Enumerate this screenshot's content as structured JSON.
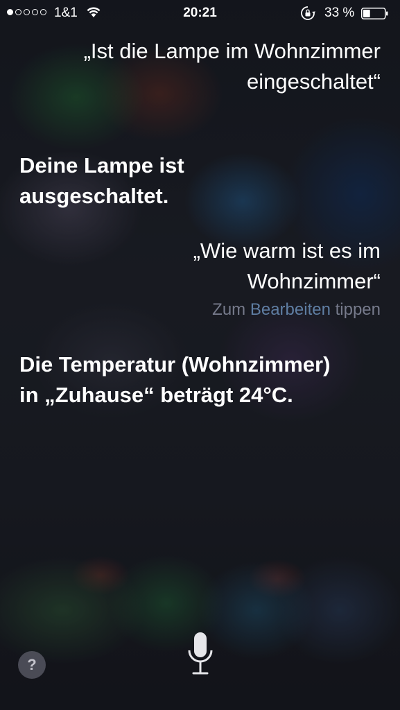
{
  "status_bar": {
    "signal_dots_filled": 1,
    "signal_dots_total": 5,
    "carrier": "1&1",
    "time": "20:21",
    "battery_percent": "33 %",
    "battery_level": 0.33
  },
  "conversation": {
    "user_query_1": "„Ist die Lampe im Wohnzimmer eingeschaltet“",
    "siri_answer_1": "Deine Lampe ist ausgeschaltet.",
    "user_query_2": "„Wie warm ist es im Wohnzimmer“",
    "tap_hint_prefix": "Zum",
    "tap_hint_accent": "Bearbeiten",
    "tap_hint_suffix": "tippen",
    "siri_answer_2": "Die Temperatur (Wohnzimmer) in „Zuhause“ beträgt 24°C."
  },
  "controls": {
    "help_label": "?",
    "help_icon": "question-mark-icon",
    "mic_icon": "microphone-icon"
  },
  "colors": {
    "text": "#ffffff",
    "hint": "#8e93a6",
    "hint_accent": "#5f7ea3"
  }
}
